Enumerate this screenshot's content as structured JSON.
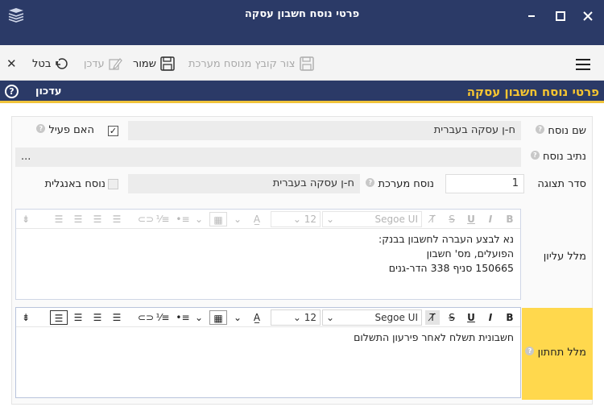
{
  "window": {
    "title": "פרטי נוסח חשבון עסקה",
    "minimize": "–",
    "maximize": "☐",
    "close": "✕"
  },
  "toolbar": {
    "menu_icon": "hamburger-icon",
    "save_attachment": "צור קובץ מנוסח מערכת",
    "save": "שמור",
    "edit": "עדכן",
    "cancel": "בטל",
    "close": "✕"
  },
  "section": {
    "title": "פרטי נוסח חשבון עסקה",
    "update_label": "עדכון",
    "help": "?"
  },
  "form": {
    "version_name_label": "שם נוסח",
    "version_name_value": "ח-ן עסקה בעברית",
    "is_active_label": "האם פעיל",
    "is_active_checked": "✓",
    "version_path_label": "נתיב נוסח",
    "version_path_value": "...",
    "display_order_label": "סדר תצוגה",
    "display_order_value": "1",
    "system_version_label": "נוסח מערכת",
    "system_version_value": "ח-ן עסקה בעברית",
    "english_version_label": "נוסח באנגלית",
    "header_label": "מלל עליון",
    "footer_label": "מלל תחתון"
  },
  "editor_top": {
    "font": "Segoe UI",
    "size": "12",
    "lines": [
      "נא לבצע העברה לחשבון בבנק:",
      "הפועלים, מס' חשבון",
      "150665 סניף 338 הדר-גנים"
    ]
  },
  "editor_bottom": {
    "font": "Segoe UI",
    "size": "12",
    "lines": [
      "חשבונית תשלח לאחר פירעון התשלום"
    ]
  },
  "format_buttons": {
    "bold": "B",
    "italic": "I",
    "underline": "U",
    "strike": "S",
    "clear": "T̸"
  },
  "colors": {
    "titlebar": "#2b3a67",
    "accent_yellow": "#f6c531",
    "active_label_bg": "#ffd84d"
  }
}
